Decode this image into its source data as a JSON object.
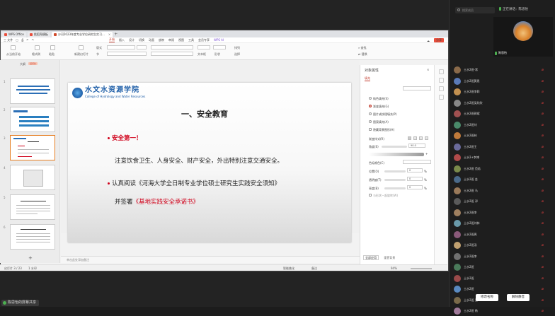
{
  "tabs": [
    {
      "label": "WPS Office",
      "color": "#e94e3c"
    },
    {
      "label": "找稻壳模板",
      "color": "#e94e3c"
    },
    {
      "label": "沙河2023年度专业学位研究生实习...",
      "color": "#d04a2b"
    }
  ],
  "menu": {
    "file": "三 文件",
    "items": [
      "开始",
      "插入",
      "设计",
      "切换",
      "动画",
      "放映",
      "审阅",
      "视图",
      "工具",
      "会员专享"
    ],
    "active": "开始",
    "wps_ai": "WPS AI",
    "share": "分享"
  },
  "ribbon": {
    "start_slideshow": "从当前开始",
    "new_slide": "新建幻灯片",
    "layout": "版式",
    "section": "节",
    "find": "查找",
    "replace": "替换",
    "format_painter": "格式刷",
    "paste": "粘贴",
    "select": "选择",
    "arrange": "排列",
    "text_box": "文本框",
    "shape": "形状"
  },
  "thumb_panel": {
    "header": "大纲",
    "tag": "幻灯片",
    "numbers": [
      "1",
      "2",
      "3",
      "4",
      "5",
      "6"
    ]
  },
  "slide": {
    "logo_cn": "水文水资源学院",
    "logo_en": "College of Hydrology and Water Resources",
    "title": "一、安全教育",
    "line1": "安全第一！",
    "line2": "注意饮食卫生、人身安全、财产安全，外出特别注意交通安全。",
    "line3": "认真阅读《河海大学全日制专业学位硕士研究生实践安全须知》",
    "line4_pre": "并签署",
    "line4_red": "《基地实践安全承诺书》"
  },
  "notes_placeholder": "单击此处添加备注",
  "status": {
    "slide_count": "幻灯片 3 / 23",
    "theme": "1 水印",
    "notes_toggle": "备注",
    "zoom": "94%",
    "smart_beautify": "智能美化"
  },
  "props": {
    "title": "对象属性",
    "fill_tab": "填充",
    "options": [
      "纯色填充(S)",
      "渐变填充(G)",
      "图片或纹理填充(P)",
      "图案填充(A)",
      "隐藏背景图形(H)"
    ],
    "selected_option": "渐变填充(G)",
    "gradient_style": "渐变样式(R)",
    "angle_label": "角度(E)",
    "angle_value": "90.0",
    "color_label": "色标颜色(C)",
    "position_label": "位置(O)",
    "position_value": "0",
    "transparency_label": "透明度(T)",
    "brightness_label": "亮度(B)",
    "value_zero": "0",
    "percent": "%",
    "shape_rotate": "与形状一起旋转(W)",
    "apply_all": "全部应用",
    "reset": "重置背景"
  },
  "meeting": {
    "search_placeholder": "搜索成员",
    "speaking": "正在讲话：陈思怡",
    "video_name": "陈思怡",
    "share_label": "陈思怡的屏幕共享",
    "invite": "修改名称",
    "mute_all": "解除静音",
    "participants": [
      {
        "name": "土水2班-常",
        "color": "#8a6a4a"
      },
      {
        "name": "土水2班黄思",
        "color": "#5a7ab8"
      },
      {
        "name": "土水2班李莉",
        "color": "#c29050"
      },
      {
        "name": "土水2班吴欣欣",
        "color": "#888888"
      },
      {
        "name": "土水2班郭斌",
        "color": "#a05050"
      },
      {
        "name": "土水2班刘",
        "color": "#4a8a6a"
      },
      {
        "name": "土水2班林",
        "color": "#c07a3a"
      },
      {
        "name": "土水2班王",
        "color": "#6a6a9a"
      },
      {
        "name": "土水2+李博",
        "color": "#b04a4a"
      },
      {
        "name": "土水2班 范若",
        "color": "#7a8a4a"
      },
      {
        "name": "土水2班 金",
        "color": "#4a6a8a"
      },
      {
        "name": "土水2班 马",
        "color": "#9a7a5a"
      },
      {
        "name": "土水2班 邓",
        "color": "#5a5a5a"
      },
      {
        "name": "土水2班李",
        "color": "#a08060"
      },
      {
        "name": "土水2班刘林",
        "color": "#6a9aaa"
      },
      {
        "name": "土水2班周",
        "color": "#8a5a7a"
      },
      {
        "name": "土水2班汤",
        "color": "#c0a070"
      },
      {
        "name": "土水2班李",
        "color": "#707070"
      },
      {
        "name": "土水2班",
        "color": "#4a7a5a"
      },
      {
        "name": "土水2班",
        "color": "#9a4a4a"
      },
      {
        "name": "土水2班",
        "color": "#5a8ac0"
      },
      {
        "name": "土水2班 张",
        "color": "#7a6a4a"
      },
      {
        "name": "土水2班 杨",
        "color": "#a07a9a"
      }
    ],
    "mic_icon": "mic-muted-icon"
  }
}
